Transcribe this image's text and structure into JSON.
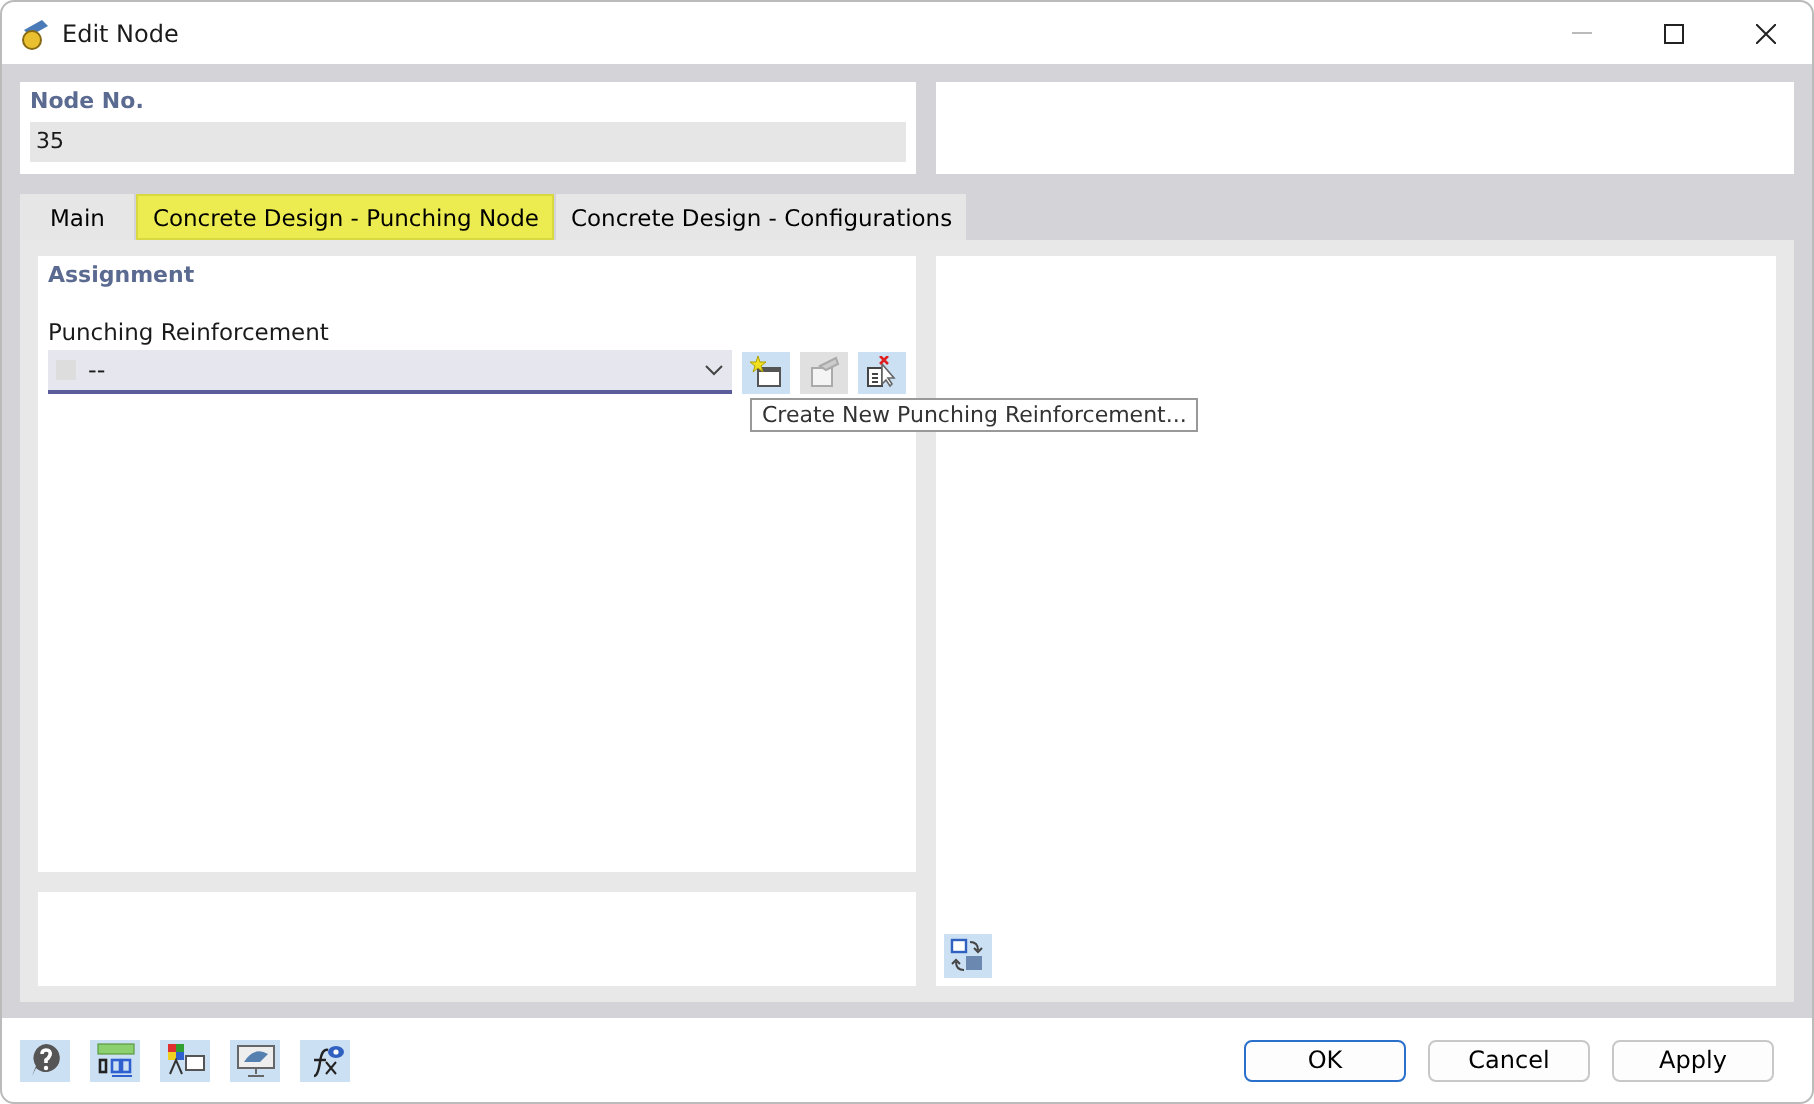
{
  "window": {
    "title": "Edit Node"
  },
  "node": {
    "label": "Node No.",
    "value": "35"
  },
  "tabs": [
    {
      "label": "Main",
      "selected": false
    },
    {
      "label": "Concrete Design - Punching Node",
      "selected": true
    },
    {
      "label": "Concrete Design - Configurations",
      "selected": false
    }
  ],
  "assignment": {
    "title": "Assignment",
    "field_label": "Punching Reinforcement",
    "value": "--",
    "tools": [
      {
        "kind": "new",
        "disabled": false
      },
      {
        "kind": "edit",
        "disabled": true
      },
      {
        "kind": "pick",
        "disabled": false
      }
    ],
    "tooltip": "Create New Punching Reinforcement..."
  },
  "footer_tools": [
    {
      "kind": "help"
    },
    {
      "kind": "units"
    },
    {
      "kind": "colors"
    },
    {
      "kind": "view"
    },
    {
      "kind": "formula"
    }
  ],
  "buttons": [
    {
      "label": "OK",
      "default": true
    },
    {
      "label": "Cancel",
      "default": false
    },
    {
      "label": "Apply",
      "default": false
    }
  ]
}
